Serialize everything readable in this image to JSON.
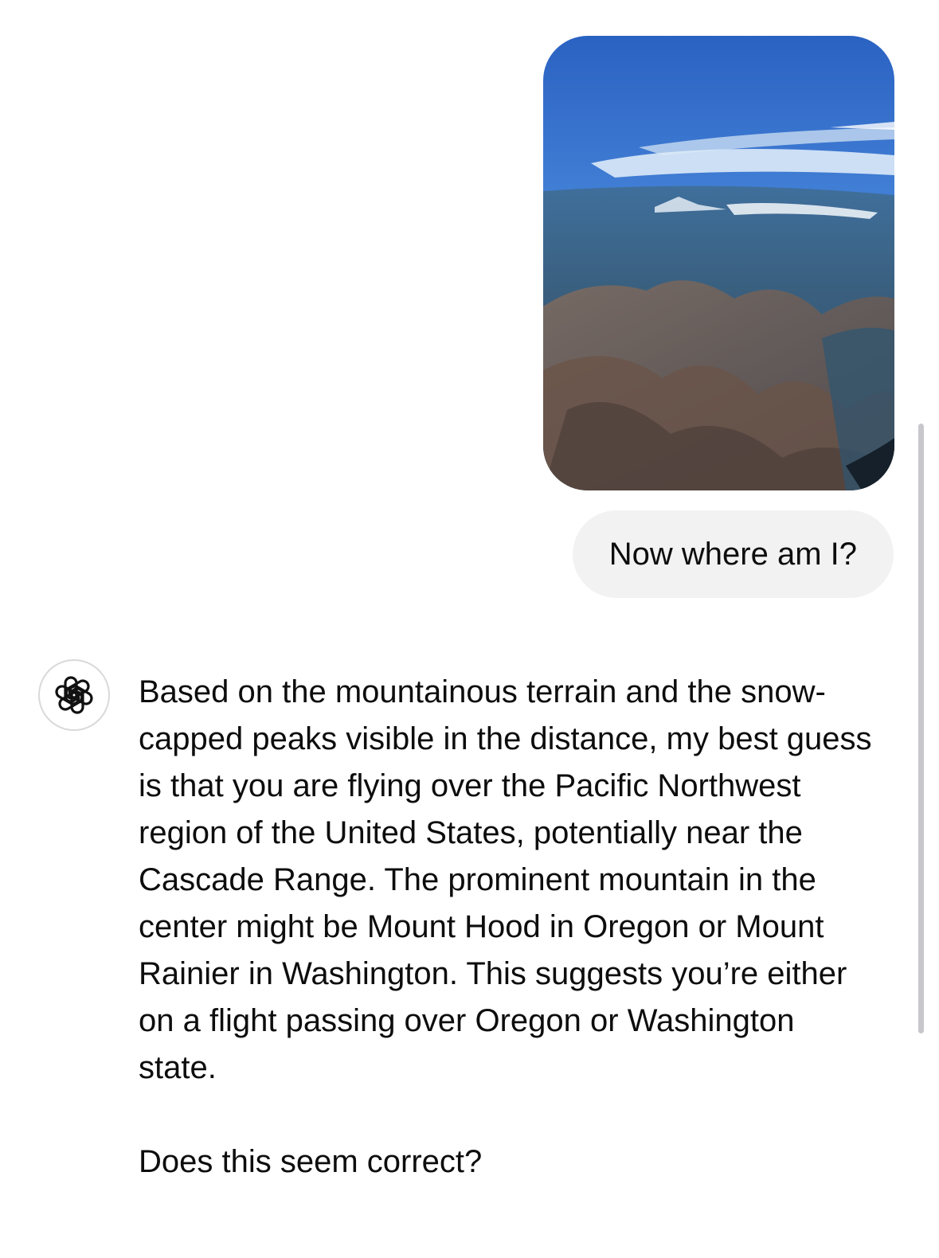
{
  "conversation": {
    "user_message": {
      "image": "aerial-mountain-photo",
      "text": "Now where am I?"
    },
    "assistant_message": {
      "avatar_icon": "openai-logo-icon",
      "paragraphs": [
        "Based on the mountainous terrain and the snow-capped peaks visible in the distance, my best guess is that you are flying over the Pacific Northwest region of the United States, potentially near the Cascade Range. The prominent mountain in the center might be Mount Hood in Oregon or Mount Rainier in Washington. This suggests you’re either on a flight passing over Oregon or Washington state.",
        "Does this seem correct?"
      ]
    }
  }
}
